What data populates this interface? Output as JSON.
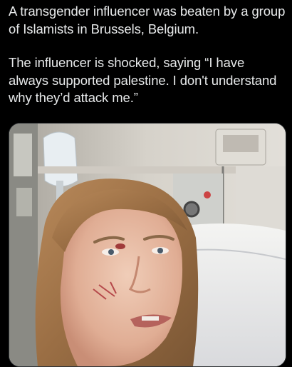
{
  "post": {
    "paragraphs": [
      "A transgender influencer was beaten by a group of Islamists in Brussels, Belgium.",
      "The influencer is shocked, saying “I have always supported palestine. I don't understand why they’d attack me.”"
    ]
  },
  "media": {
    "kind": "video-still",
    "icon": "video-thumbnail"
  },
  "colors": {
    "background": "#000000",
    "text": "#e7e9ea",
    "border": "#2f3336"
  }
}
